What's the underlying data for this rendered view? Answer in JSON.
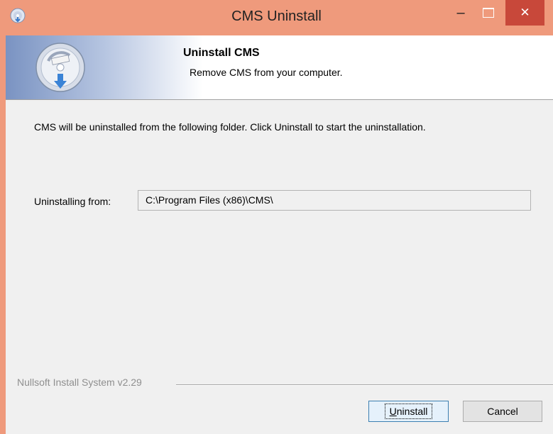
{
  "window": {
    "title": "CMS Uninstall",
    "icons": {
      "app": "app-icon",
      "minimize": "minimize-icon",
      "maximize": "maximize-icon",
      "close": "close-icon"
    },
    "close_glyph": "✕",
    "minimize_glyph": "–"
  },
  "header": {
    "title": "Uninstall CMS",
    "subtitle": "Remove CMS from your computer.",
    "icon": "uninstall-disc-icon"
  },
  "body": {
    "intro": "CMS will be uninstalled from the following folder. Click Uninstall to start the uninstallation.",
    "from_label": "Uninstalling from:",
    "from_value": "C:\\Program Files (x86)\\CMS\\"
  },
  "footer": {
    "branding": "Nullsoft Install System v2.29",
    "uninstall_prefix": "U",
    "uninstall_rest": "ninstall",
    "cancel_label": "Cancel"
  },
  "colors": {
    "titlebar": "#ef9a7c",
    "close_button": "#c8483a",
    "client_bg": "#f0f0f0"
  }
}
